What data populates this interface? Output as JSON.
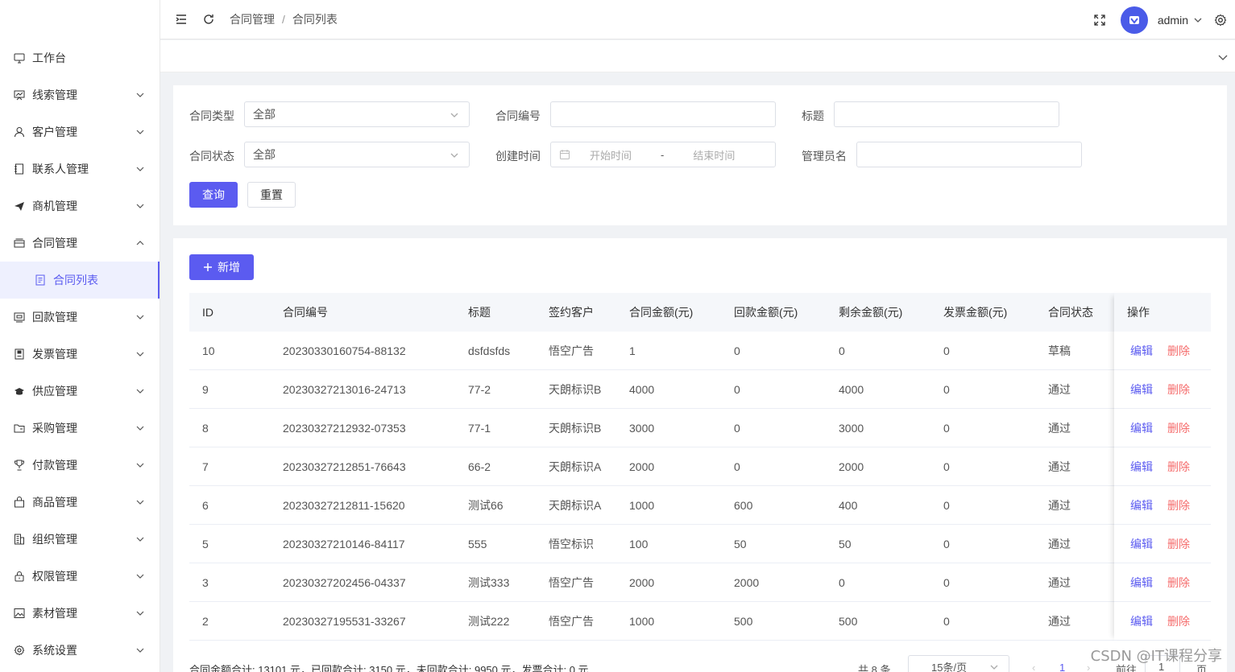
{
  "sidebar": {
    "items": [
      {
        "label": "工作台",
        "icon": "monitor-icon",
        "expandable": false
      },
      {
        "label": "线索管理",
        "icon": "clue-icon",
        "expandable": true
      },
      {
        "label": "客户管理",
        "icon": "user-icon",
        "expandable": true
      },
      {
        "label": "联系人管理",
        "icon": "contacts-book-icon",
        "expandable": true
      },
      {
        "label": "商机管理",
        "icon": "paper-plane-icon",
        "expandable": true
      },
      {
        "label": "合同管理",
        "icon": "contract-box-icon",
        "expandable": true,
        "expanded": true
      },
      {
        "label": "合同列表",
        "icon": "document-icon",
        "sub": true,
        "active": true
      },
      {
        "label": "回款管理",
        "icon": "payment-icon",
        "expandable": true
      },
      {
        "label": "发票管理",
        "icon": "invoice-icon",
        "expandable": true
      },
      {
        "label": "供应管理",
        "icon": "supply-icon",
        "expandable": true
      },
      {
        "label": "采购管理",
        "icon": "folder-icon",
        "expandable": true
      },
      {
        "label": "付款管理",
        "icon": "trophy-icon",
        "expandable": true
      },
      {
        "label": "商品管理",
        "icon": "bag-icon",
        "expandable": true
      },
      {
        "label": "组织管理",
        "icon": "building-icon",
        "expandable": true
      },
      {
        "label": "权限管理",
        "icon": "lock-icon",
        "expandable": true
      },
      {
        "label": "素材管理",
        "icon": "image-icon",
        "expandable": true
      },
      {
        "label": "系统设置",
        "icon": "gear-icon",
        "expandable": true
      }
    ]
  },
  "header": {
    "breadcrumb": [
      "合同管理",
      "合同列表"
    ],
    "breadcrumb_sep": "/",
    "username": "admin"
  },
  "search": {
    "contract_type_label": "合同类型",
    "contract_type_value": "全部",
    "contract_no_label": "合同编号",
    "title_label": "标题",
    "contract_status_label": "合同状态",
    "contract_status_value": "全部",
    "created_time_label": "创建时间",
    "start_placeholder": "开始时间",
    "range_sep": "-",
    "end_placeholder": "结束时间",
    "admin_label": "管理员名",
    "query_button": "查询",
    "reset_button": "重置"
  },
  "table": {
    "add_button": "新增",
    "columns": [
      "ID",
      "合同编号",
      "标题",
      "签约客户",
      "合同金额(元)",
      "回款金额(元)",
      "剩余金额(元)",
      "发票金额(元)",
      "合同状态",
      "操作"
    ],
    "rows": [
      [
        "10",
        "20230330160754-88132",
        "dsfdsfds",
        "悟空广告",
        "1",
        "0",
        "0",
        "0",
        "草稿"
      ],
      [
        "9",
        "20230327213016-24713",
        "77-2",
        "天朗标识B",
        "4000",
        "0",
        "4000",
        "0",
        "通过"
      ],
      [
        "8",
        "20230327212932-07353",
        "77-1",
        "天朗标识B",
        "3000",
        "0",
        "3000",
        "0",
        "通过"
      ],
      [
        "7",
        "20230327212851-76643",
        "66-2",
        "天朗标识A",
        "2000",
        "0",
        "2000",
        "0",
        "通过"
      ],
      [
        "6",
        "20230327212811-15620",
        "测试66",
        "天朗标识A",
        "1000",
        "600",
        "400",
        "0",
        "通过"
      ],
      [
        "5",
        "20230327210146-84117",
        "555",
        "悟空标识",
        "100",
        "50",
        "50",
        "0",
        "通过"
      ],
      [
        "3",
        "20230327202456-04337",
        "测试333",
        "悟空广告",
        "2000",
        "2000",
        "0",
        "0",
        "通过"
      ],
      [
        "2",
        "20230327195531-33267",
        "测试222",
        "悟空广告",
        "1000",
        "500",
        "500",
        "0",
        "通过"
      ]
    ],
    "edit_label": "编辑",
    "delete_label": "删除"
  },
  "footer": {
    "summary": "合同金额合计: 13101 元，已回款合计: 3150 元，未回款合计: 9950 元，发票合计: 0 元",
    "total": "共 8 条",
    "page_size": "15条/页",
    "current_page": "1",
    "goto_label": "前往",
    "goto_value": "1",
    "page_suffix": "页"
  },
  "watermark": "CSDN @IT课程分享",
  "colors": {
    "primary": "#5b5bf0",
    "danger": "#f56c6c"
  }
}
